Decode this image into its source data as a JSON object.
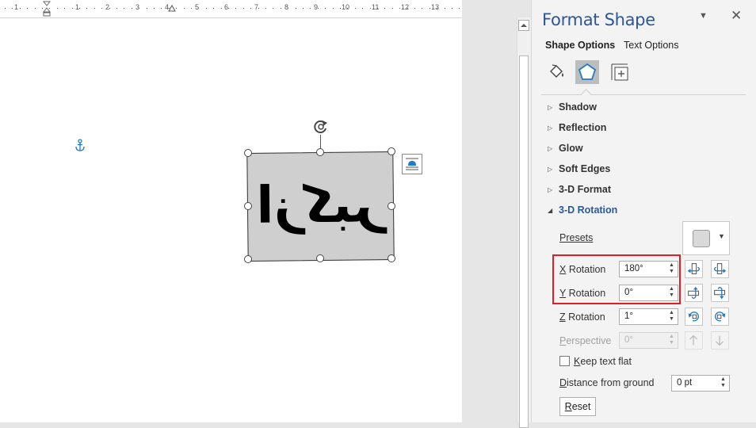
{
  "ruler": {
    "numbers": [
      "1",
      "1",
      "2",
      "3",
      "4",
      "5",
      "6",
      "7",
      "8",
      "9",
      "10",
      "11",
      "12",
      "13"
    ]
  },
  "document": {
    "shape_text": "ازکبر"
  },
  "pane": {
    "title": "Format Shape",
    "dropdown_glyph": "▼",
    "close_glyph": "✕",
    "tabs": {
      "shape_options": "Shape Options",
      "text_options": "Text Options"
    },
    "category_icons": [
      "fill-line-icon",
      "effects-icon",
      "layout-properties-icon"
    ],
    "sections": {
      "shadow": "Shadow",
      "reflection": "Reflection",
      "glow": "Glow",
      "soft_edges": "Soft Edges",
      "format_3d": "3-D Format",
      "rotation_3d": "3-D Rotation"
    },
    "rotation": {
      "presets_label": "Presets",
      "x_label_key": "X",
      "x_label_rest": " Rotation",
      "x_value": "180°",
      "y_label_key": "Y",
      "y_label_rest": " Rotation",
      "y_value": "0°",
      "z_label_key": "Z",
      "z_label_rest": " Rotation",
      "z_value": "1°",
      "perspective_label_key": "P",
      "perspective_label_rest": "erspective",
      "perspective_value": "0°",
      "keep_flat_label_key": "K",
      "keep_flat_label_rest": "eep text flat",
      "keep_flat_checked": false,
      "distance_label_key": "D",
      "distance_label_rest": "istance from ground",
      "distance_value": "0 pt",
      "reset_label_key": "R",
      "reset_label_rest": "eset"
    }
  },
  "colors": {
    "accent": "#2b579a",
    "highlight": "#e01e23",
    "icon_blue": "#1e7bc8"
  }
}
